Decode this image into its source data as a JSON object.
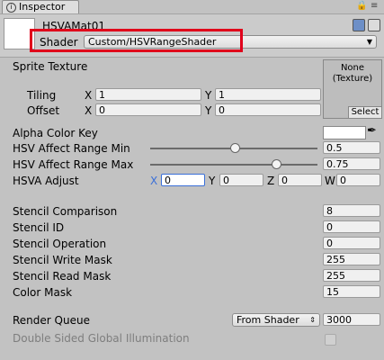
{
  "window": {
    "tab_label": "Inspector"
  },
  "material": {
    "name": "HSVAMat01",
    "shader_label": "Shader",
    "shader_value": "Custom/HSVRangeShader"
  },
  "sprite_texture": {
    "label": "Sprite Texture",
    "tiling_label": "Tiling",
    "offset_label": "Offset",
    "x_label": "X",
    "y_label": "Y",
    "tiling_x": "1",
    "tiling_y": "1",
    "offset_x": "0",
    "offset_y": "0",
    "texture_none": "None\n(Texture)",
    "select_label": "Select"
  },
  "props": {
    "alpha_color_key": "Alpha Color Key",
    "hsv_min_label": "HSV Affect Range Min",
    "hsv_min_value": "0.5",
    "hsv_min_fraction": 0.5,
    "hsv_max_label": "HSV Affect Range Max",
    "hsv_max_value": "0.75",
    "hsv_max_fraction": 0.75,
    "hsva_label": "HSVA Adjust",
    "hsva": {
      "x_label": "X",
      "x": "0",
      "y_label": "Y",
      "y": "0",
      "z_label": "Z",
      "z": "0",
      "w_label": "W",
      "w": "0"
    }
  },
  "stencil": [
    {
      "label": "Stencil Comparison",
      "value": "8"
    },
    {
      "label": "Stencil ID",
      "value": "0"
    },
    {
      "label": "Stencil Operation",
      "value": "0"
    },
    {
      "label": "Stencil Write Mask",
      "value": "255"
    },
    {
      "label": "Stencil Read Mask",
      "value": "255"
    },
    {
      "label": "Color Mask",
      "value": "15"
    }
  ],
  "render_queue": {
    "label": "Render Queue",
    "mode": "From Shader",
    "value": "3000"
  },
  "double_sided": {
    "label": "Double Sided Global Illumination"
  },
  "icons": {
    "tab": "inspector-icon",
    "lock": "lock-icon",
    "menu": "menu-icon",
    "book": "book-icon",
    "gear": "gear-icon",
    "picker": "eyedropper-icon"
  },
  "colors": {
    "highlight": "#e0001b",
    "focus": "#3a6fd8"
  }
}
